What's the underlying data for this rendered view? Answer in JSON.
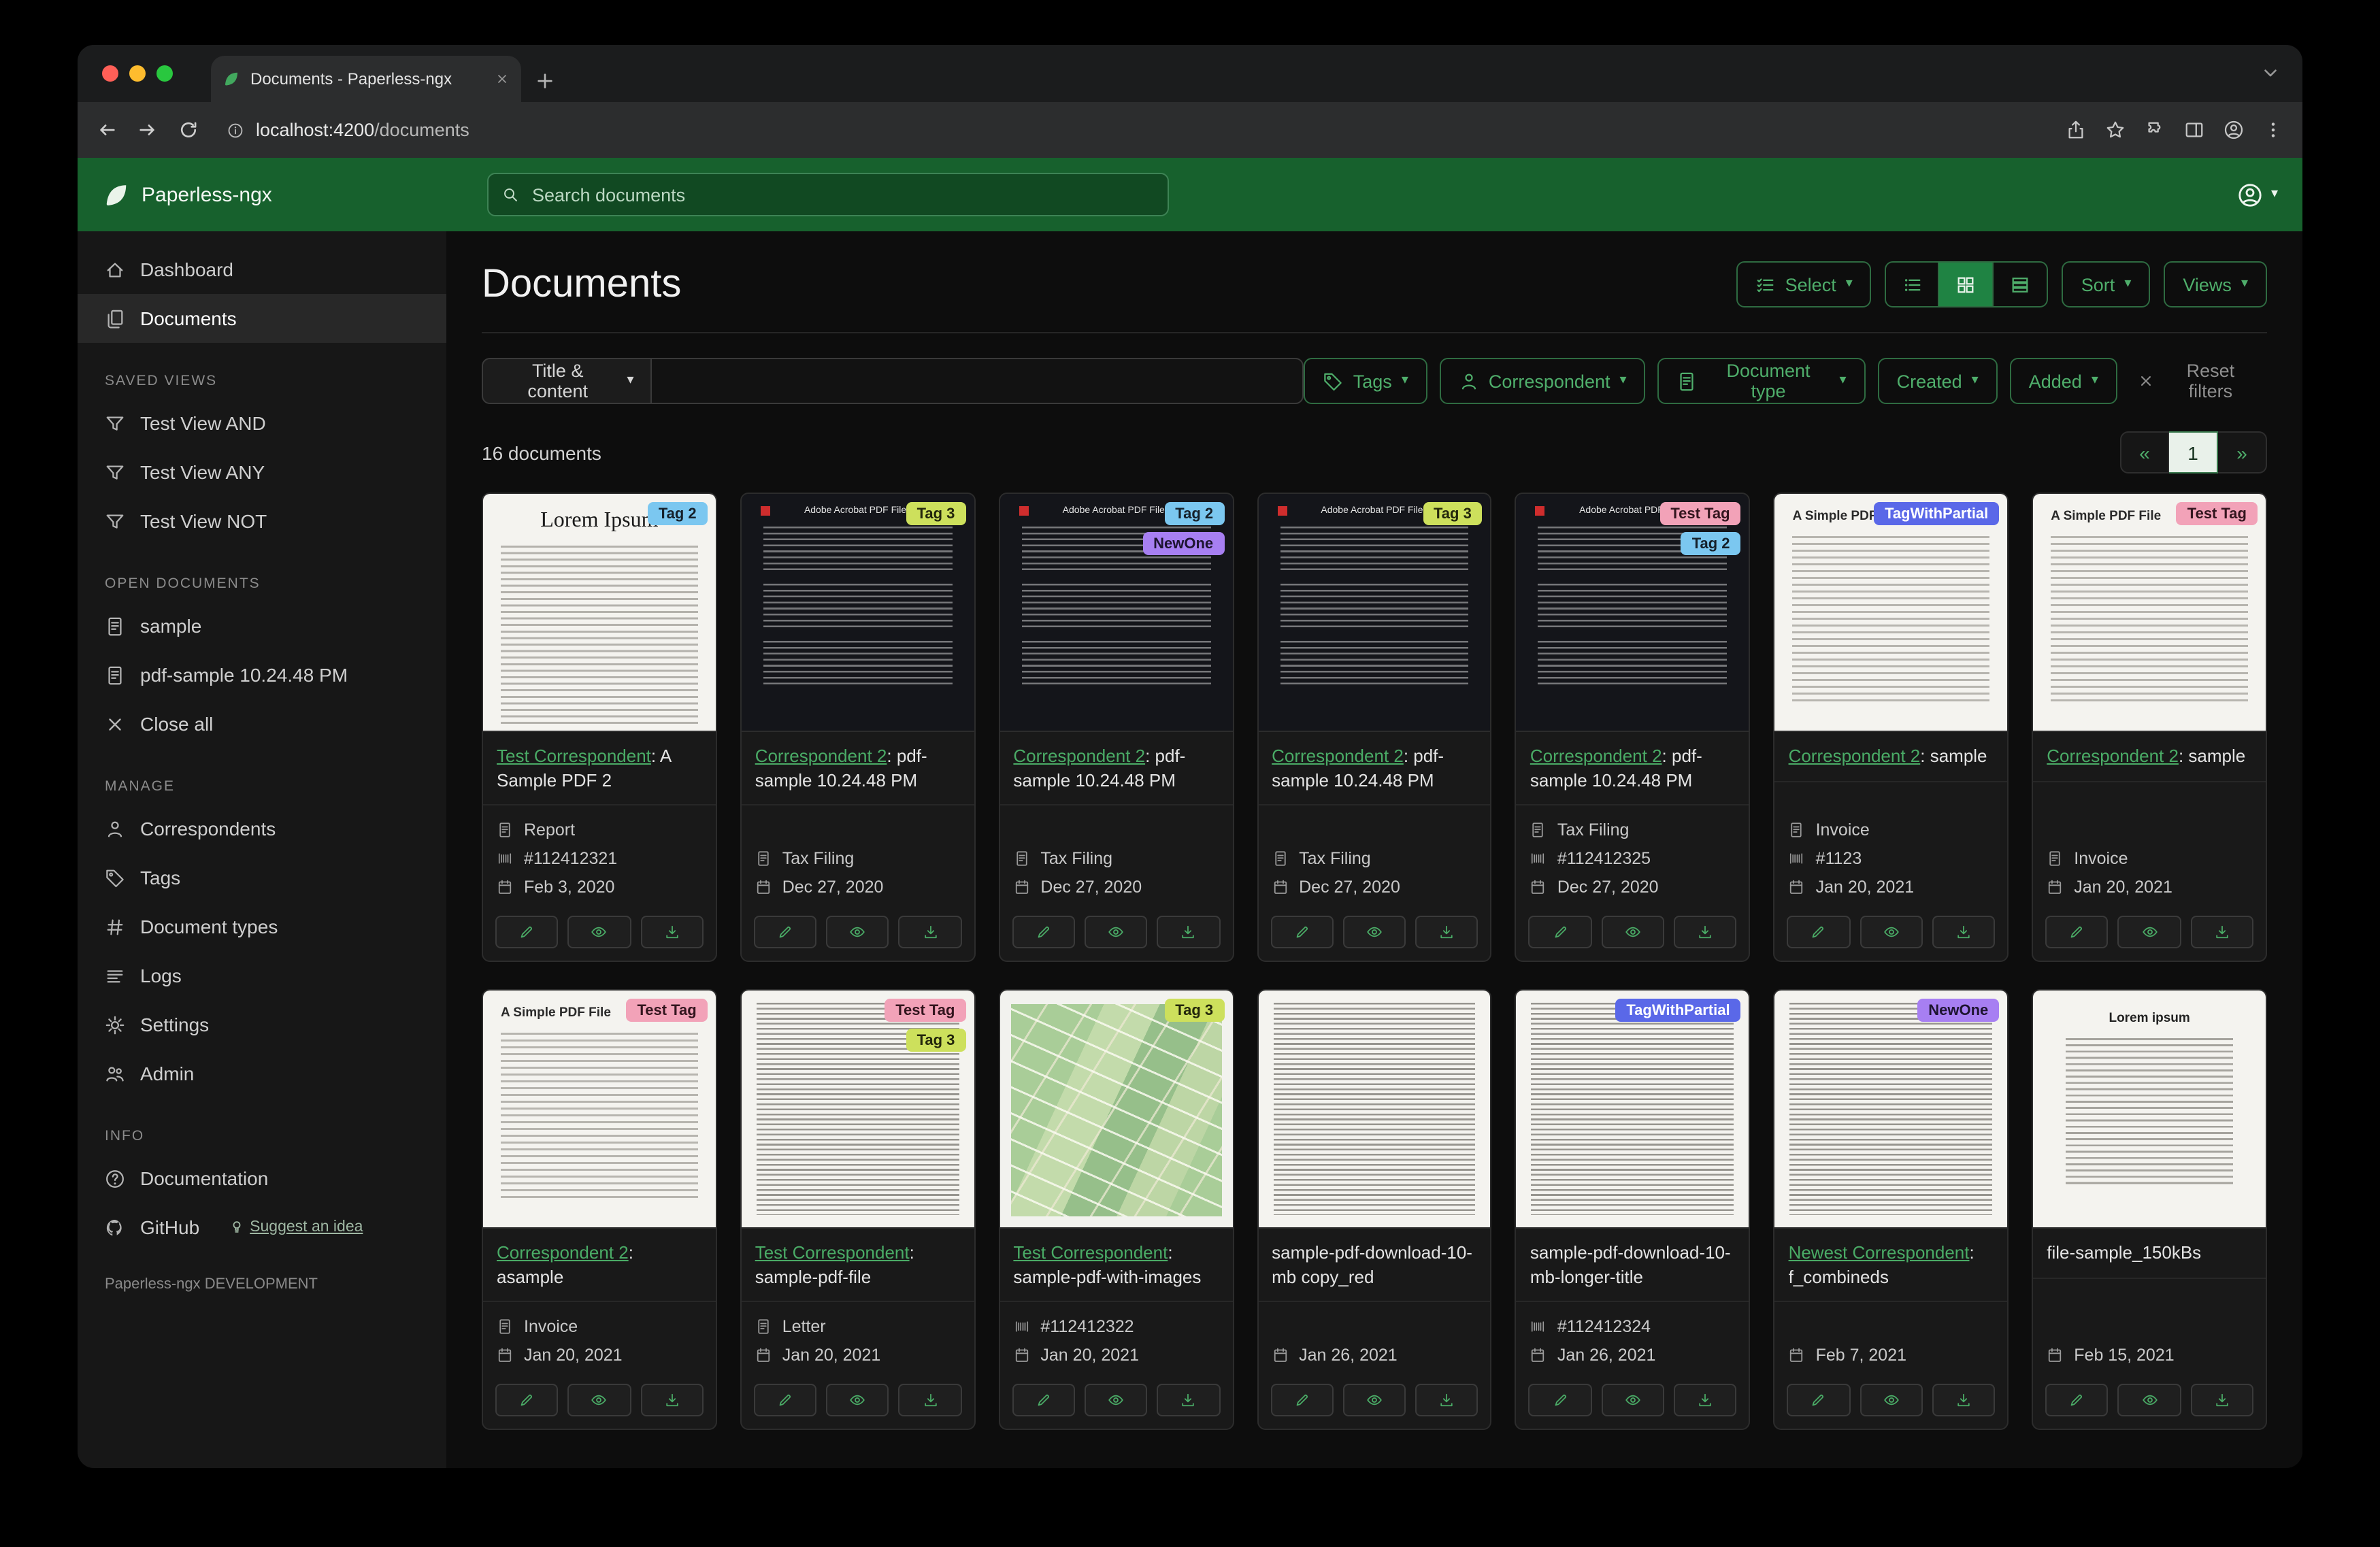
{
  "browser": {
    "tab": {
      "title": "Documents - Paperless-ngx"
    },
    "url": {
      "host": "localhost:4200",
      "path": "/documents"
    }
  },
  "header": {
    "brand": "Paperless-ngx",
    "search_placeholder": "Search documents"
  },
  "sidebar": {
    "primary": [
      {
        "icon": "dashboard-icon",
        "label": "Dashboard",
        "active": false
      },
      {
        "icon": "documents-icon",
        "label": "Documents",
        "active": true
      }
    ],
    "sections": [
      {
        "title": "SAVED VIEWS",
        "items": [
          {
            "icon": "filter-icon",
            "label": "Test View AND"
          },
          {
            "icon": "filter-icon",
            "label": "Test View ANY"
          },
          {
            "icon": "filter-icon",
            "label": "Test View NOT"
          }
        ]
      },
      {
        "title": "OPEN DOCUMENTS",
        "items": [
          {
            "icon": "file-icon",
            "label": "sample"
          },
          {
            "icon": "file-icon",
            "label": "pdf-sample 10.24.48 PM"
          },
          {
            "icon": "close-icon",
            "label": "Close all"
          }
        ]
      },
      {
        "title": "MANAGE",
        "items": [
          {
            "icon": "person-icon",
            "label": "Correspondents"
          },
          {
            "icon": "tag-icon",
            "label": "Tags"
          },
          {
            "icon": "hash-icon",
            "label": "Document types"
          },
          {
            "icon": "logs-icon",
            "label": "Logs"
          },
          {
            "icon": "gear-icon",
            "label": "Settings"
          },
          {
            "icon": "people-icon",
            "label": "Admin"
          }
        ]
      },
      {
        "title": "INFO",
        "items": [
          {
            "icon": "question-icon",
            "label": "Documentation"
          },
          {
            "icon": "github-icon",
            "label": "GitHub",
            "extra": "Suggest an idea"
          }
        ]
      }
    ],
    "footer": "Paperless-ngx DEVELOPMENT"
  },
  "main": {
    "title": "Documents",
    "toolbar": {
      "select_label": "Select",
      "sort_label": "Sort",
      "views_label": "Views"
    },
    "filters": {
      "title_content_label": "Title & content",
      "tags_label": "Tags",
      "correspondent_label": "Correspondent",
      "document_type_label": "Document type",
      "created_label": "Created",
      "added_label": "Added",
      "reset_label": "Reset filters"
    },
    "count": "16 documents",
    "pagination": {
      "prev": "«",
      "page": "1",
      "next": "»"
    }
  },
  "tags": {
    "tag2": {
      "label": "Tag 2",
      "bg": "#7bc7f0",
      "fg": "#15202a"
    },
    "tag3": {
      "label": "Tag 3",
      "bg": "#cde05c",
      "fg": "#23270c"
    },
    "newone": {
      "label": "NewOne",
      "bg": "#a77ff2",
      "fg": "#1d1430"
    },
    "testtag": {
      "label": "Test Tag",
      "bg": "#f2a2b8",
      "fg": "#33151e"
    },
    "tagwithpartial": {
      "label": "TagWithPartial",
      "bg": "#5a68e8",
      "fg": "#ffffff"
    }
  },
  "documents": [
    {
      "tags": [
        "tag2"
      ],
      "thumb": {
        "style": "lorem",
        "heading": "Lorem Ipsum"
      },
      "title_link": "Test Correspondent",
      "title_rest": ": A Sample PDF 2",
      "meta": [
        {
          "icon": "doctype-icon",
          "text": "Report"
        },
        {
          "icon": "asn-icon",
          "text": "#112412321"
        },
        {
          "icon": "calendar-icon",
          "text": "Feb 3, 2020"
        }
      ]
    },
    {
      "tags": [
        "tag3"
      ],
      "thumb": {
        "style": "dark",
        "heading": "Adobe Acrobat PDF Files"
      },
      "title_link": "Correspondent 2",
      "title_rest": ": pdf-sample 10.24.48 PM",
      "meta": [
        {
          "icon": "doctype-icon",
          "text": "Tax Filing"
        },
        {
          "icon": "calendar-icon",
          "text": "Dec 27, 2020"
        }
      ]
    },
    {
      "tags": [
        "tag2",
        "newone"
      ],
      "thumb": {
        "style": "dark",
        "heading": "Adobe Acrobat PDF Files"
      },
      "title_link": "Correspondent 2",
      "title_rest": ": pdf-sample 10.24.48 PM",
      "meta": [
        {
          "icon": "doctype-icon",
          "text": "Tax Filing"
        },
        {
          "icon": "calendar-icon",
          "text": "Dec 27, 2020"
        }
      ]
    },
    {
      "tags": [
        "tag3"
      ],
      "thumb": {
        "style": "dark",
        "heading": "Adobe Acrobat PDF Files"
      },
      "title_link": "Correspondent 2",
      "title_rest": ": pdf-sample 10.24.48 PM",
      "meta": [
        {
          "icon": "doctype-icon",
          "text": "Tax Filing"
        },
        {
          "icon": "calendar-icon",
          "text": "Dec 27, 2020"
        }
      ]
    },
    {
      "tags": [
        "testtag",
        "tag2"
      ],
      "thumb": {
        "style": "dark",
        "heading": "Adobe Acrobat PDF Files"
      },
      "title_link": "Correspondent 2",
      "title_rest": ": pdf-sample 10.24.48 PM",
      "meta": [
        {
          "icon": "doctype-icon",
          "text": "Tax Filing"
        },
        {
          "icon": "asn-icon",
          "text": "#112412325"
        },
        {
          "icon": "calendar-icon",
          "text": "Dec 27, 2020"
        }
      ]
    },
    {
      "tags": [
        "tagwithpartial"
      ],
      "thumb": {
        "style": "simple",
        "heading": "A Simple PDF File"
      },
      "title_link": "Correspondent 2",
      "title_rest": ": sample",
      "meta": [
        {
          "icon": "doctype-icon",
          "text": "Invoice"
        },
        {
          "icon": "asn-icon",
          "text": "#1123"
        },
        {
          "icon": "calendar-icon",
          "text": "Jan 20, 2021"
        }
      ]
    },
    {
      "tags": [
        "testtag"
      ],
      "thumb": {
        "style": "simple",
        "heading": "A Simple PDF File"
      },
      "title_link": "Correspondent 2",
      "title_rest": ": sample",
      "meta": [
        {
          "icon": "doctype-icon",
          "text": "Invoice"
        },
        {
          "icon": "calendar-icon",
          "text": "Jan 20, 2021"
        }
      ]
    },
    {
      "tags": [
        "testtag"
      ],
      "thumb": {
        "style": "simple",
        "heading": "A Simple PDF File"
      },
      "title_link": "Correspondent 2",
      "title_rest": ": asample",
      "meta": [
        {
          "icon": "doctype-icon",
          "text": "Invoice"
        },
        {
          "icon": "calendar-icon",
          "text": "Jan 20, 2021"
        }
      ]
    },
    {
      "tags": [
        "testtag",
        "tag3"
      ],
      "thumb": {
        "style": "dense",
        "heading": ""
      },
      "title_link": "Test Correspondent",
      "title_rest": ": sample-pdf-file",
      "meta": [
        {
          "icon": "doctype-icon",
          "text": "Letter"
        },
        {
          "icon": "calendar-icon",
          "text": "Jan 20, 2021"
        }
      ]
    },
    {
      "tags": [
        "tag3"
      ],
      "thumb": {
        "style": "map",
        "heading": ""
      },
      "title_link": "Test Correspondent",
      "title_rest": ": sample-pdf-with-images",
      "meta": [
        {
          "icon": "asn-icon",
          "text": "#112412322"
        },
        {
          "icon": "calendar-icon",
          "text": "Jan 20, 2021"
        }
      ]
    },
    {
      "tags": [],
      "thumb": {
        "style": "dense",
        "heading": ""
      },
      "title_link": null,
      "title_rest": "sample-pdf-download-10-mb copy_red",
      "meta": [
        {
          "icon": "calendar-icon",
          "text": "Jan 26, 2021"
        }
      ]
    },
    {
      "tags": [
        "tagwithpartial"
      ],
      "thumb": {
        "style": "dense",
        "heading": ""
      },
      "title_link": null,
      "title_rest": "sample-pdf-download-10-mb-longer-title",
      "meta": [
        {
          "icon": "asn-icon",
          "text": "#112412324"
        },
        {
          "icon": "calendar-icon",
          "text": "Jan 26, 2021"
        }
      ]
    },
    {
      "tags": [
        "newone"
      ],
      "thumb": {
        "style": "dense",
        "heading": ""
      },
      "title_link": "Newest Correspondent",
      "title_rest": ": f_combineds",
      "meta": [
        {
          "icon": "calendar-icon",
          "text": "Feb 7, 2021"
        }
      ]
    },
    {
      "tags": [],
      "thumb": {
        "style": "loremcenter",
        "heading": "Lorem ipsum"
      },
      "title_link": null,
      "title_rest": "file-sample_150kBs",
      "meta": [
        {
          "icon": "calendar-icon",
          "text": "Feb 15, 2021"
        }
      ]
    }
  ]
}
